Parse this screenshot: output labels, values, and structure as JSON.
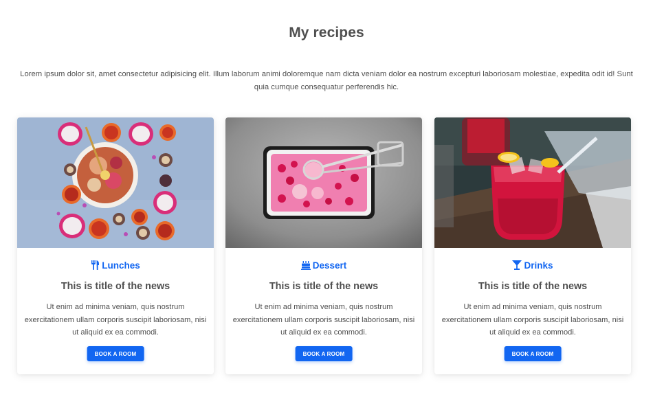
{
  "section": {
    "title": "My recipes",
    "intro": "Lorem ipsum dolor sit, amet consectetur adipisicing elit. Illum laborum animi doloremque nam dicta veniam dolor ea nostrum excepturi laboriosam molestiae, expedita odit id! Sunt quia cumque consequatur perferendis hic."
  },
  "colors": {
    "accent": "#1266f1",
    "text": "#4f4f4f"
  },
  "cards": [
    {
      "image": "fruit-bowl-photo",
      "category_icon": "utensils-icon",
      "category": "Lunches",
      "title": "This is title of the news",
      "text": "Ut enim ad minima veniam, quis nostrum exercitationem ullam corporis suscipit laboriosam, nisi ut aliquid ex ea commodi.",
      "button": "Book a room"
    },
    {
      "image": "ice-cream-tray-photo",
      "category_icon": "birthday-cake-icon",
      "category": "Dessert",
      "title": "This is title of the news",
      "text": "Ut enim ad minima veniam, quis nostrum exercitationem ullam corporis suscipit laboriosam, nisi ut aliquid ex ea commodi.",
      "button": "Book a room"
    },
    {
      "image": "red-cocktail-photo",
      "category_icon": "cocktail-glass-icon",
      "category": "Drinks",
      "title": "This is title of the news",
      "text": "Ut enim ad minima veniam, quis nostrum exercitationem ullam corporis suscipit laboriosam, nisi ut aliquid ex ea commodi.",
      "button": "Book a room"
    }
  ]
}
